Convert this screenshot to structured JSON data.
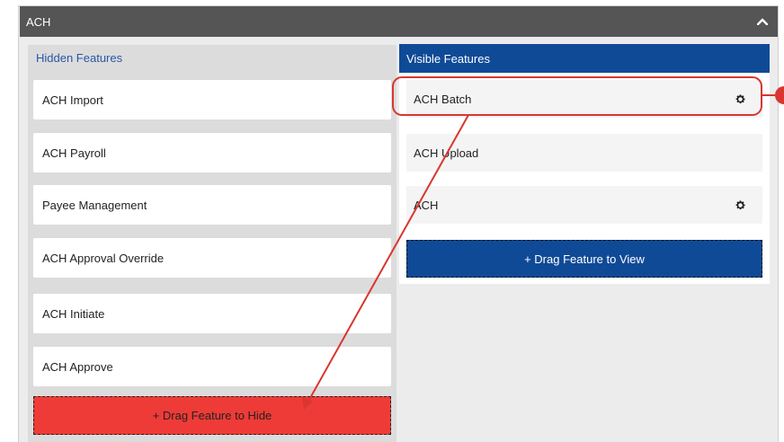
{
  "section": {
    "title": "ACH"
  },
  "hidden": {
    "title": "Hidden Features",
    "items": [
      {
        "label": "ACH Import"
      },
      {
        "label": "ACH Payroll"
      },
      {
        "label": "Payee Management"
      },
      {
        "label": "ACH Approval Override"
      },
      {
        "label": "ACH Initiate"
      },
      {
        "label": "ACH Approve"
      }
    ],
    "drop_label": "+ Drag Feature to Hide"
  },
  "visible": {
    "title": "Visible Features",
    "items": [
      {
        "label": "ACH Batch",
        "icon": "gear-icon"
      },
      {
        "label": "ACH Upload"
      },
      {
        "label": "ACH",
        "icon": "gear-icon"
      }
    ],
    "drop_label": "+ Drag Feature to View"
  },
  "colors": {
    "header": "#555555",
    "visible_title_bg": "#0f4a97",
    "hidden_title_text": "#2a56a8",
    "drop_hide": "#ef3b37",
    "annotation": "#d9362f"
  }
}
